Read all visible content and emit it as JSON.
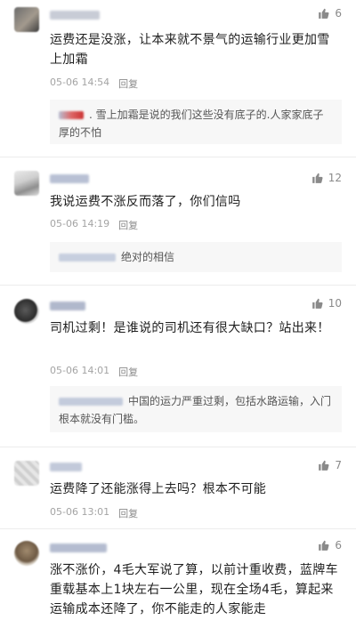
{
  "comments": [
    {
      "likes": "6",
      "content": "运费还是没涨，让本来就不景气的运输行业更加雪上加霜",
      "time": "05-06 14:54",
      "reply_label": "回复",
      "sub_reply": ". 雪上加霜是说的我们这些没有底子的.人家家底子厚的不怕"
    },
    {
      "likes": "12",
      "content": "我说运费不涨反而落了，你们信吗",
      "time": "05-06 14:19",
      "reply_label": "回复",
      "sub_reply": "绝对的相信"
    },
    {
      "likes": "10",
      "content": "司机过剩！是谁说的司机还有很大缺口？站出来！",
      "time": "05-06 14:01",
      "reply_label": "回复",
      "sub_reply": "中国的运力严重过剩，包括水路运输，入门根本就没有门槛。"
    },
    {
      "likes": "7",
      "content": "运费降了还能涨得上去吗？根本不可能",
      "time": "05-06 13:01",
      "reply_label": "回复"
    },
    {
      "likes": "6",
      "content": "涨不涨价，4毛大军说了算，以前计重收费，蓝牌车重载基本上1块左右一公里，现在全场4毛，算起来运输成本还降了，你不能走的人家能走"
    }
  ],
  "colors": {
    "text": "#1f1f1f",
    "meta": "#a4a4a4",
    "reply_bg": "#f7f7f7"
  },
  "icons": {
    "like": "thumbs-up-icon"
  }
}
